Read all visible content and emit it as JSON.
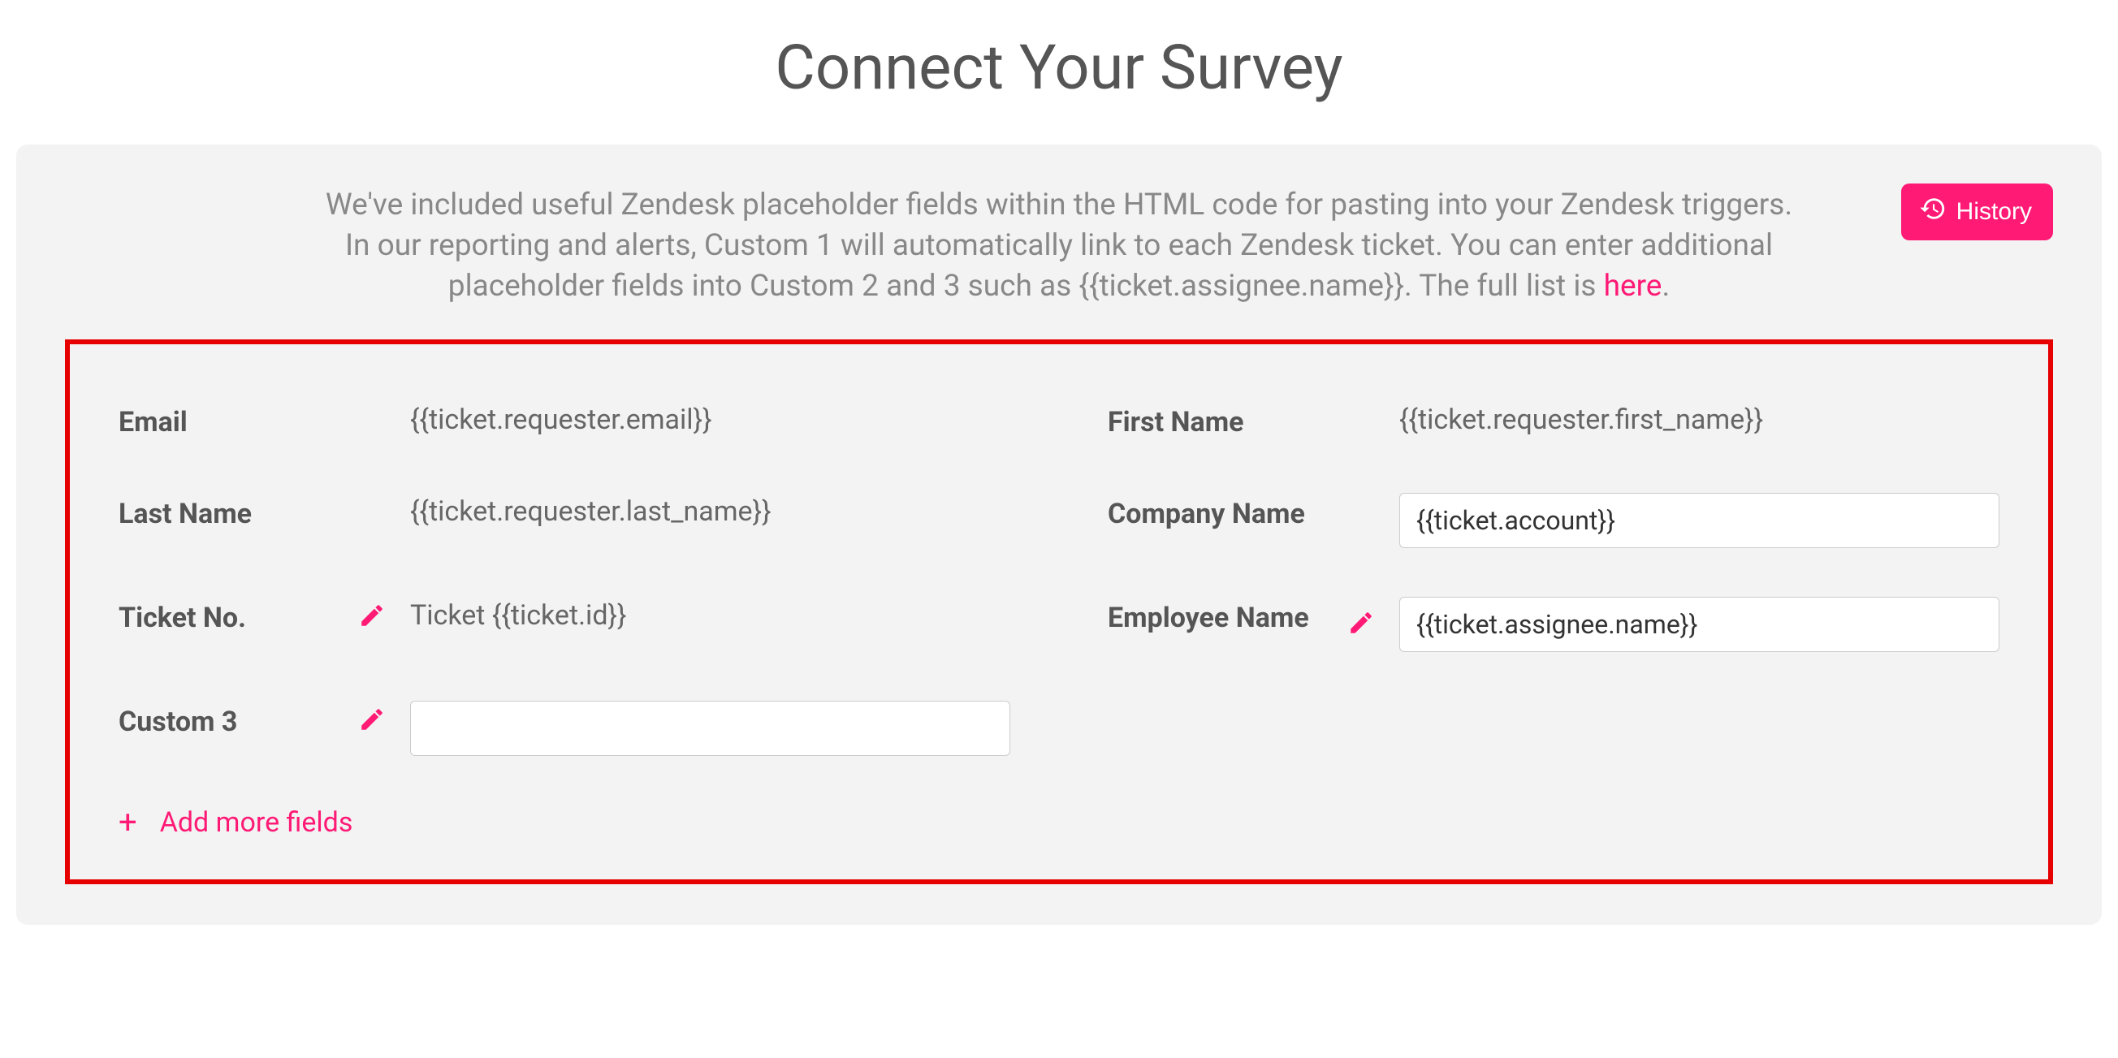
{
  "page": {
    "title": "Connect Your Survey"
  },
  "panel": {
    "intro_part1": "We've included useful Zendesk placeholder fields within the HTML code for pasting into your Zendesk triggers. In our reporting and alerts, Custom 1 will automatically link to each Zendesk ticket. You can enter additional placeholder fields into Custom 2 and 3 such as {{ticket.assignee.name}}. The full list is ",
    "intro_link_text": "here",
    "intro_part2": ".",
    "history_label": "History"
  },
  "fields": {
    "email": {
      "label": "Email",
      "value": "{{ticket.requester.email}}"
    },
    "first_name": {
      "label": "First Name",
      "value": "{{ticket.requester.first_name}}"
    },
    "last_name": {
      "label": "Last Name",
      "value": "{{ticket.requester.last_name}}"
    },
    "company_name": {
      "label": "Company Name",
      "value": "{{ticket.account}}"
    },
    "ticket_no": {
      "label": "Ticket No.",
      "value": "Ticket {{ticket.id}}"
    },
    "employee_name": {
      "label": "Employee Name",
      "value": "{{ticket.assignee.name}}"
    },
    "custom3": {
      "label": "Custom 3",
      "value": ""
    }
  },
  "actions": {
    "add_more": "Add more fields"
  },
  "colors": {
    "accent": "#ff1a75",
    "highlight_border": "#e60000"
  }
}
